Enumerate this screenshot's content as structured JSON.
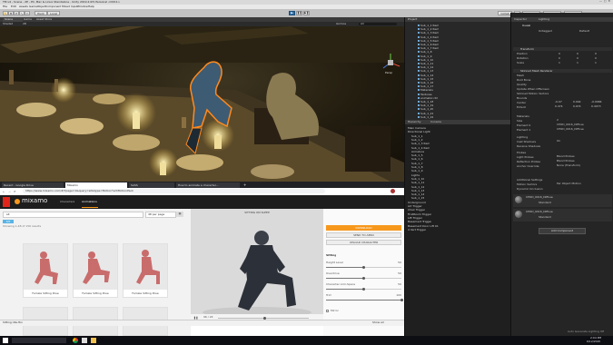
{
  "unity": {
    "title": "TM v4 - Scene - 2E - PC, Mac & Linux Standalone - Unity 2019.2.0f1 Personal <DX11>",
    "menu": [
      "File",
      "Edit",
      "Assets",
      "GameObject",
      "Component",
      "Mixed Input",
      "Window",
      "Help"
    ],
    "toolbar": {
      "pivot": "Pivot",
      "local": "Local",
      "collab": "Collab",
      "account": "Account",
      "layers": "Layers",
      "layout": "Layout"
    },
    "scene_tabs": [
      "Scene",
      "Game",
      "Asset Store"
    ],
    "scene_bar": {
      "shading": "Shaded",
      "mode": "2D",
      "gizmos": "Gizmos",
      "search": "All"
    },
    "persp_label": "Persp",
    "project_header": "Project",
    "project_items": [
      "Sub_1_1 Item",
      "Sub_1_2 Item",
      "Sub_1_3 Item",
      "Sub_1_4 Item",
      "Sub_1_5 Item",
      "Sub_1_6 Item",
      "Sub_1_7 Item",
      "Sub_1_8",
      "Sub_1_9",
      "Sub_1_10",
      "Sub_1_11",
      "Sub_1_12",
      "Sub_1_13",
      "Sub_1_14",
      "Sub_1_15",
      "Sub_1_16",
      "Sub_1_17",
      "Materials",
      "Textures",
      "animator.ctrl",
      "Sub_1_18",
      "Sub_1_19",
      "Sub_1_20",
      "Sub_1_21",
      "Sub_1_22"
    ],
    "console_tabs": [
      "Hierarchy",
      "Console"
    ],
    "hierarchy_items": [
      "Main Camera",
      "Directional Light",
      "Sub_1_1",
      "Sub_1_2",
      "Sub_1_3 Item",
      "Sub_1_4 Item",
      "Armature",
      "Sub_1_5",
      "Sub_1_6",
      "Sub_1_7",
      "Sub_1_8",
      "Sub_1_9",
      "Lights",
      "Sub_1_10",
      "Sub_1_11",
      "Sub_1_12",
      "Sub_1_13",
      "Sub_1_14",
      "Sub_1_15",
      "Underground",
      "Art Trigger",
      "Chair Trigger",
      "FirstRoom Trigger",
      "Lift Trigger",
      "Basement Trigger",
      "Basement Door Lift 01",
      "4 Vert Trigger"
    ],
    "inspector": {
      "tabs": [
        "Inspector",
        "Lighting"
      ],
      "object_name": "Uuwal",
      "tag": "Untagged",
      "layer": "Default",
      "transform_header": "Transform",
      "position": [
        "Position",
        "0",
        "0",
        "0"
      ],
      "rotation": [
        "Rotation",
        "0",
        "0",
        "0"
      ],
      "scale": [
        "Scale",
        "1",
        "1",
        "1"
      ],
      "smr_header": "Skinned Mesh Renderer",
      "smr_rows": [
        "Mesh",
        "Root Bone",
        "Quality",
        "Update When Offscreen",
        "Skinned Motion Vectors",
        "Bounds",
        "Center",
        "Extent"
      ],
      "center": [
        "-0.07",
        "0.004",
        "-0.0084"
      ],
      "extent": [
        "0.474",
        "0.974",
        "0.4473"
      ],
      "materials_header": "Materials",
      "materials": [
        "Size",
        "Element 0",
        "Element 1"
      ],
      "material_values": [
        "2",
        "CH0D_0016_Diffuse",
        "CH0D_0016_Diffuse"
      ],
      "lighting_header": "Lighting",
      "lighting_rows": [
        "Cast Shadows",
        "Receive Shadows"
      ],
      "lighting_values": [
        "On",
        ""
      ],
      "probes_header": "Probes",
      "probes_rows": [
        "Light Probes",
        "Reflection Probes",
        "Anchor Override"
      ],
      "probes_values": [
        "Blend Probes",
        "Blend Probes",
        "None (Transform)"
      ],
      "add_settings_header": "Additional Settings",
      "add_settings_rows": [
        "Motion Vectors",
        "Dynamic Occlusion"
      ],
      "add_settings_values": [
        "Per Object Motion",
        ""
      ],
      "material_cards": [
        {
          "name": "CH0D_0016_Diffuse",
          "shader": "Standard"
        },
        {
          "name": "CH0D_0016_Diffuse",
          "shader": "Standard"
        }
      ],
      "add_component": "Add Component"
    },
    "status": "Auto Generate Lighting Off"
  },
  "browser": {
    "tabs": [
      "Recent - Google Drive",
      "Mixamo",
      "SASS",
      "How to animate a character..."
    ],
    "url": "https://www.mixamo.com/#/?page=1&query=sit&type=Motion%2CMotionPack",
    "mixamo": {
      "brand": "mixamo",
      "nav": [
        "Characters",
        "Animations"
      ],
      "search_query": "sit",
      "per_page": "48 per page",
      "tag": "SIT",
      "results_label": "Showing 1-48 of 156 results",
      "cards": [
        "Female Sitting Pose",
        "Female Sitting Pose",
        "Female Sitting Pose"
      ],
      "preview_title": "SITTING ON SLEEP",
      "preview_frame": "96 / 24",
      "panel": {
        "download": "DOWNLOAD",
        "send_to_aero": "SEND TO AERO",
        "upload": "UPLOAD CHARACTER",
        "anim_title": "Sitting",
        "sliders": [
          {
            "label": "Height Level",
            "value": 50,
            "fraction": 0.5
          },
          {
            "label": "Overdrive",
            "value": 50,
            "fraction": 0.5
          },
          {
            "label": "Character Arm-Space",
            "value": 50,
            "fraction": 0.5
          },
          {
            "label": "Trim",
            "value": 100,
            "fraction": 1.0
          }
        ],
        "mirror": "Mirror"
      }
    },
    "downloads_bar": {
      "file": "Sitting Idle.fbx",
      "show_all": "Show all"
    }
  },
  "taskbar": {
    "time": "2:04 PM",
    "date": "6/12/2020"
  },
  "colors": {
    "unity_dark": "#282828",
    "mixamo_orange": "#f7981d",
    "selection_orange": "#ff8a1f"
  }
}
